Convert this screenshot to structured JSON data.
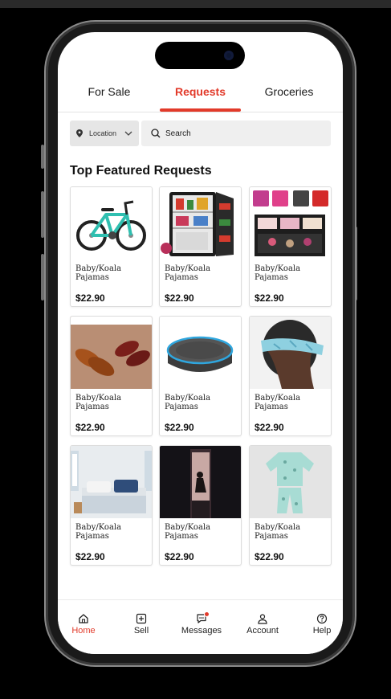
{
  "tabs": [
    {
      "label": "For Sale"
    },
    {
      "label": "Requests",
      "active": true
    },
    {
      "label": "Groceries"
    }
  ],
  "location": {
    "label": "Location"
  },
  "search": {
    "placeholder": "Search"
  },
  "section_title": "Top Featured Requests",
  "products": [
    {
      "name": "Baby/Koala Pajamas",
      "price": "$22.90",
      "image": "bicycle"
    },
    {
      "name": "Baby/Koala Pajamas",
      "price": "$22.90",
      "image": "mini-fridge"
    },
    {
      "name": "Baby/Koala Pajamas",
      "price": "$22.90",
      "image": "makeup-case"
    },
    {
      "name": "Baby/Koala Pajamas",
      "price": "$22.90",
      "image": "dress-shoes"
    },
    {
      "name": "Baby/Koala Pajamas",
      "price": "$22.90",
      "image": "smart-speaker"
    },
    {
      "name": "Baby/Koala Pajamas",
      "price": "$22.90",
      "image": "headband"
    },
    {
      "name": "Baby/Koala Pajamas",
      "price": "$22.90",
      "image": "bedroom"
    },
    {
      "name": "Baby/Koala Pajamas",
      "price": "$22.90",
      "image": "dark-scene"
    },
    {
      "name": "Baby/Koala Pajamas",
      "price": "$22.90",
      "image": "pajamas"
    }
  ],
  "nav": [
    {
      "label": "Home",
      "icon": "home-icon",
      "active": true
    },
    {
      "label": "Sell",
      "icon": "plus-square-icon"
    },
    {
      "label": "Messages",
      "icon": "chat-icon",
      "badge": true
    },
    {
      "label": "Account",
      "icon": "user-icon"
    },
    {
      "label": "Help",
      "icon": "help-icon"
    }
  ],
  "colors": {
    "accent": "#e23a2a",
    "background": "#ffffff",
    "field": "#e6e6e6"
  }
}
